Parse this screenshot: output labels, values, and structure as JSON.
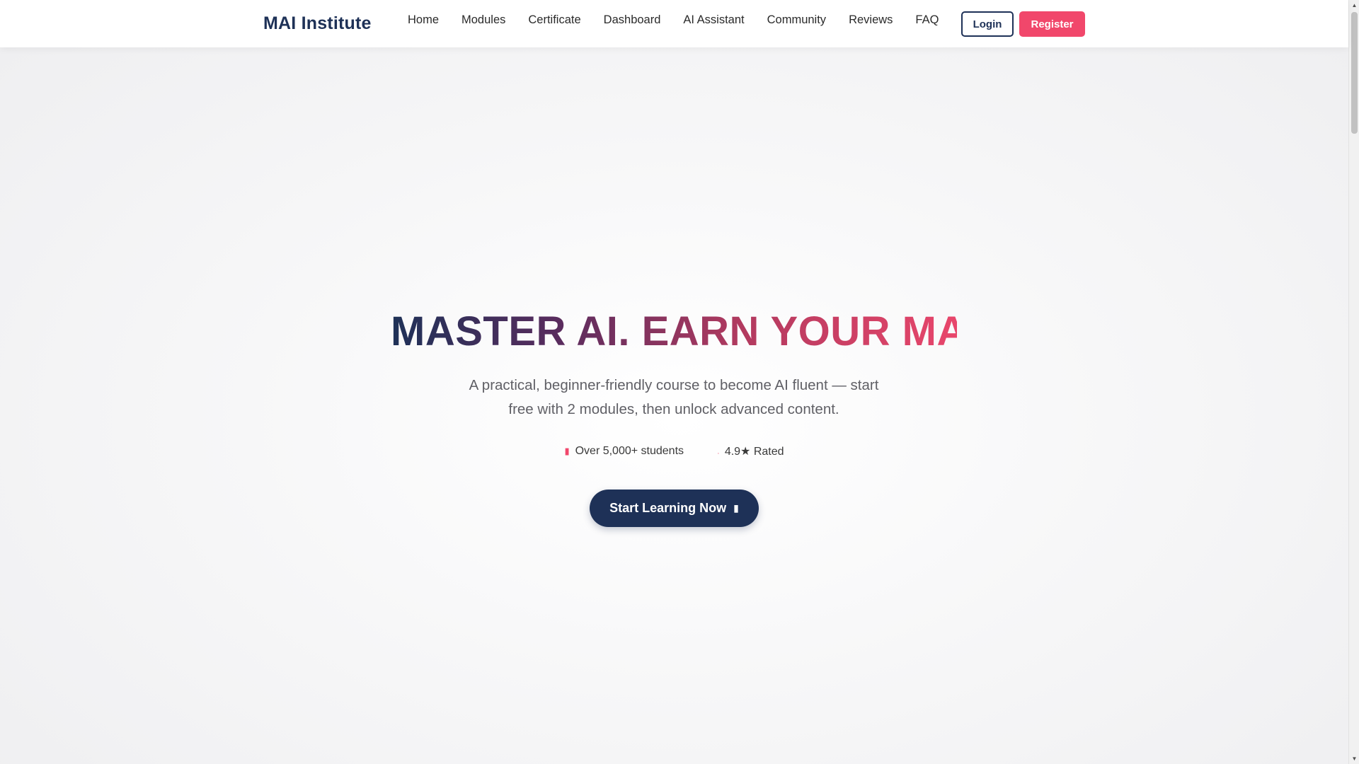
{
  "header": {
    "brand": "MAI Institute",
    "nav": [
      {
        "label": "Home"
      },
      {
        "label": "Modules"
      },
      {
        "label": "Certificate"
      },
      {
        "label": "Dashboard"
      },
      {
        "label": "AI Assistant"
      },
      {
        "label": "Community"
      },
      {
        "label": "Reviews"
      },
      {
        "label": "FAQ"
      }
    ],
    "login_label": "Login",
    "register_label": "Register"
  },
  "hero": {
    "title": "MASTER AI. EARN YOUR MAI.",
    "subtitle": "A practical, beginner-friendly course to become AI fluent — start free with 2 modules, then unlock advanced content.",
    "stats": [
      {
        "icon": "users-icon",
        "text": "Over 5,000+ students"
      },
      {
        "icon": "star-icon",
        "text": "4.9★ Rated"
      }
    ],
    "cta_label": "Start Learning Now",
    "cta_icon": "arrow-right-icon"
  },
  "colors": {
    "brand_navy": "#1e3157",
    "accent_pink": "#f1476b"
  }
}
